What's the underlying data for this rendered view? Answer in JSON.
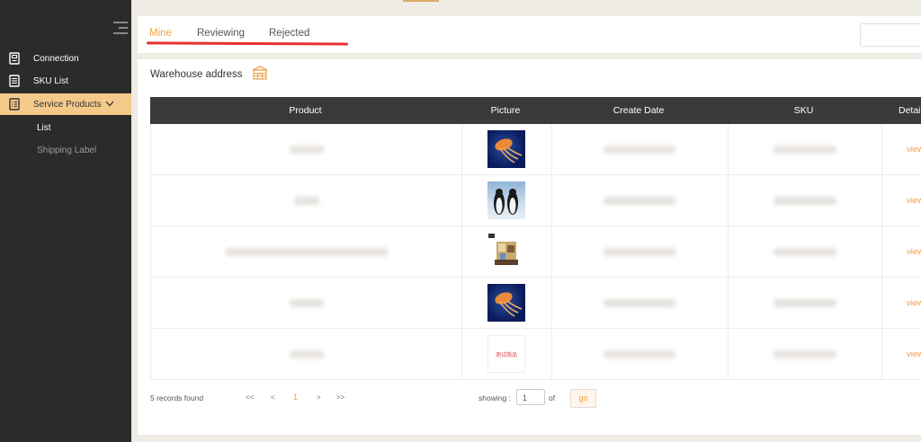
{
  "sidebar": {
    "items": [
      {
        "label": "Connection",
        "icon": "document-icon"
      },
      {
        "label": "SKU List",
        "icon": "list-icon"
      },
      {
        "label": "Service Products",
        "icon": "checklist-icon",
        "expanded": true
      }
    ],
    "sub_items": [
      {
        "label": "List",
        "active": true
      },
      {
        "label": "Shipping Label",
        "active": false
      }
    ]
  },
  "tabs": [
    {
      "label": "Mine",
      "active": true
    },
    {
      "label": "Reviewing",
      "active": false
    },
    {
      "label": "Rejected",
      "active": false
    }
  ],
  "warehouse_label": "Warehouse address",
  "table": {
    "columns": [
      "Product",
      "Picture",
      "Create Date",
      "SKU",
      "Detail"
    ],
    "rows": [
      {
        "product": "",
        "picture": "jellyfish",
        "create_date": "",
        "sku": "",
        "detail": "view"
      },
      {
        "product": "",
        "picture": "penguins",
        "create_date": "",
        "sku": "",
        "detail": "view"
      },
      {
        "product": "",
        "picture": "house-model",
        "create_date": "",
        "sku": "",
        "detail": "view"
      },
      {
        "product": "",
        "picture": "jellyfish",
        "create_date": "",
        "sku": "",
        "detail": "view"
      },
      {
        "product": "",
        "picture": "test-product-image",
        "picture_text": "测试商品",
        "create_date": "",
        "sku": "",
        "detail": "view"
      }
    ]
  },
  "pagination": {
    "records": "5 records found",
    "first": "<<",
    "prev": "<",
    "current": "1",
    "next": ">",
    "last": ">>",
    "showing_label": "showing :",
    "page_value": "1",
    "of_label": "of",
    "go_label": "go"
  },
  "colors": {
    "accent": "#f0a040",
    "sidebar_bg": "#2b2b2b",
    "active_nav": "#f4c98a",
    "underline": "#e8312f",
    "header_bg": "#3a3a3a"
  }
}
